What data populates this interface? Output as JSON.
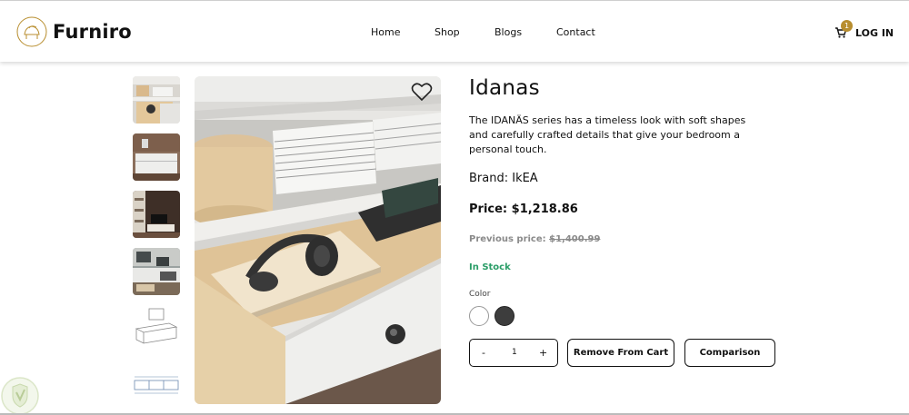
{
  "brand": {
    "name": "Furniro",
    "icon": "chair-logo-icon"
  },
  "nav": {
    "items": [
      "Home",
      "Shop",
      "Blogs",
      "Contact"
    ]
  },
  "cart": {
    "icon": "cart-icon",
    "count": "1",
    "badge_color": "#B88E2F"
  },
  "auth": {
    "login_label": "LOG IN"
  },
  "gallery": {
    "thumbnails": [
      "thumb-1",
      "thumb-2",
      "thumb-3",
      "thumb-4",
      "thumb-5",
      "thumb-6"
    ],
    "wishlist_icon": "heart-icon"
  },
  "product": {
    "title": "Idanas",
    "description": "The IDANÄS series has a timeless look with soft shapes and carefully crafted details that give your bedroom a personal touch.",
    "brand_label": "Brand: IkEA",
    "price_label": "Price: $1,218.86",
    "previous_price_label": "Previous price:",
    "previous_price": "$1,400.99",
    "stock": "In Stock",
    "stock_color": "#2a9d67",
    "color_label": "Color",
    "colors": [
      "#ffffff",
      "#3d3d3d"
    ]
  },
  "quantity": {
    "minus": "-",
    "value": "1",
    "plus": "+"
  },
  "actions": {
    "remove_label": "Remove From Cart",
    "compare_label": "Comparison"
  }
}
